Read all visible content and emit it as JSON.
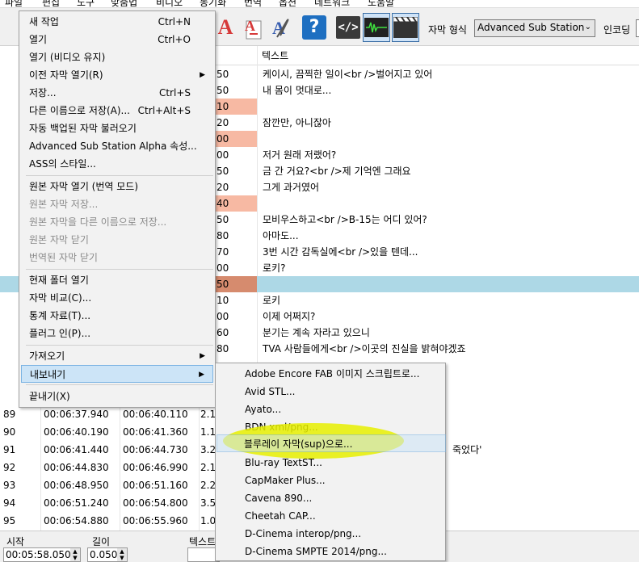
{
  "menubar": {
    "items": [
      "파일",
      "편집",
      "도구",
      "맞춤법",
      "비디오",
      "동기화",
      "번역",
      "옵션",
      "네트워크",
      "도움말"
    ]
  },
  "toolbar": {
    "format_label": "자막 형식",
    "format_value": "Advanced Sub Station",
    "encoding_label": "인코딩",
    "help_glyph": "?",
    "source_glyph": "</>"
  },
  "grid": {
    "header_text": "텍스트",
    "rows_top": [
      {
        "dur": "50",
        "text": "케이시, 끔찍한 일이<br />벌어지고 있어",
        "bg": ""
      },
      {
        "dur": "50",
        "text": "내 몸이 멋대로...",
        "bg": ""
      },
      {
        "dur": "10",
        "text": "",
        "bg": "#f7b9a3"
      },
      {
        "dur": "20",
        "text": "잠깐만, 아니잖아",
        "bg": ""
      },
      {
        "dur": "00",
        "text": "",
        "bg": "#f7b9a3"
      },
      {
        "dur": "00",
        "text": "저거 원래 저랬어?",
        "bg": ""
      },
      {
        "dur": "50",
        "text": "금 간 거요?<br />제 기억엔 그래요",
        "bg": ""
      },
      {
        "dur": "20",
        "text": "그게 과거였어",
        "bg": ""
      },
      {
        "dur": "40",
        "text": "",
        "bg": "#f7b9a3"
      },
      {
        "dur": "50",
        "text": "모비우스하고<br />B-15는 어디 있어?",
        "bg": ""
      },
      {
        "dur": "80",
        "text": "아마도...",
        "bg": ""
      },
      {
        "dur": "70",
        "text": "3번 시간 감독실에<br />있을 텐데...",
        "bg": ""
      },
      {
        "dur": "00",
        "text": "로키?",
        "bg": ""
      },
      {
        "dur": "50",
        "text": "",
        "bg": "#d68b6e",
        "selected": true
      },
      {
        "dur": "10",
        "text": "로키",
        "bg": ""
      },
      {
        "dur": "00",
        "text": "이제 어쩌지?",
        "bg": ""
      },
      {
        "dur": "60",
        "text": "분기는 계속 자라고 있으니",
        "bg": ""
      },
      {
        "dur": "80",
        "text": "TVA 사람들에게<br />이곳의 진실을 밝혀야겠죠",
        "bg": ""
      }
    ],
    "rows_bottom": [
      {
        "num": "89",
        "start": "00:06:37.940",
        "end": "00:06:40.110",
        "dur": "2.1"
      },
      {
        "num": "90",
        "start": "00:06:40.190",
        "end": "00:06:41.360",
        "dur": "1.1"
      },
      {
        "num": "91",
        "start": "00:06:41.440",
        "end": "00:06:44.730",
        "dur": "3.2",
        "text": "죽었다'"
      },
      {
        "num": "92",
        "start": "00:06:44.830",
        "end": "00:06:46.990",
        "dur": "2.1"
      },
      {
        "num": "93",
        "start": "00:06:48.950",
        "end": "00:06:51.160",
        "dur": "2.2"
      },
      {
        "num": "94",
        "start": "00:06:51.240",
        "end": "00:06:54.800",
        "dur": "3.5"
      },
      {
        "num": "95",
        "start": "00:06:54.880",
        "end": "00:06:55.960",
        "dur": "1.0"
      }
    ]
  },
  "bottom": {
    "start_label": "시작",
    "start_value": "00:05:58.050",
    "length_label": "길이",
    "length_value": "0.050",
    "text_label": "텍스트"
  },
  "file_menu": {
    "items": [
      {
        "label": "새 작업",
        "shortcut": "Ctrl+N"
      },
      {
        "label": "열기",
        "shortcut": "Ctrl+O"
      },
      {
        "label": "열기 (비디오 유지)"
      },
      {
        "label": "이전 자막 열기(R)",
        "submenu": true
      },
      {
        "label": "저장...",
        "shortcut": "Ctrl+S"
      },
      {
        "label": "다른 이름으로 저장(A)...",
        "shortcut": "Ctrl+Alt+S"
      },
      {
        "label": "자동 백업된 자막 불러오기"
      },
      {
        "label": "Advanced Sub Station Alpha 속성..."
      },
      {
        "label": "ASS의 스타일..."
      },
      {
        "label": "원본 자막 열기 (번역 모드)"
      },
      {
        "label": "원본 자막 저장...",
        "disabled": true
      },
      {
        "label": "원본 자막을 다른 이름으로 저장...",
        "disabled": true
      },
      {
        "label": "원본 자막 닫기",
        "disabled": true
      },
      {
        "label": "번역된 자막 닫기",
        "disabled": true
      },
      {
        "label": "현재 폴더 열기"
      },
      {
        "label": "자막 비교(C)..."
      },
      {
        "label": "통계 자료(T)..."
      },
      {
        "label": "플러그 인(P)..."
      },
      {
        "label": "가져오기",
        "submenu": true
      },
      {
        "label": "내보내기",
        "submenu": true,
        "highlighted": true
      },
      {
        "label": "끝내기(X)"
      }
    ]
  },
  "export_menu": {
    "items": [
      {
        "label": "Adobe Encore FAB 이미지 스크립트로..."
      },
      {
        "label": "Avid STL..."
      },
      {
        "label": "Ayato..."
      },
      {
        "label": "BDN xml/png..."
      },
      {
        "label": "블루레이 자막(sup)으로...",
        "highlighted": true
      },
      {
        "label": "Blu-ray TextST..."
      },
      {
        "label": "CapMaker Plus..."
      },
      {
        "label": "Cavena 890..."
      },
      {
        "label": "Cheetah CAP..."
      },
      {
        "label": "D-Cinema interop/png..."
      },
      {
        "label": "D-Cinema SMPTE 2014/png..."
      }
    ]
  },
  "colors": {
    "highlight_marker": "#e8f000",
    "selected_row": "#add8e6",
    "error_cell": "#f7b9a3",
    "selected_cell": "#d68b6e"
  }
}
